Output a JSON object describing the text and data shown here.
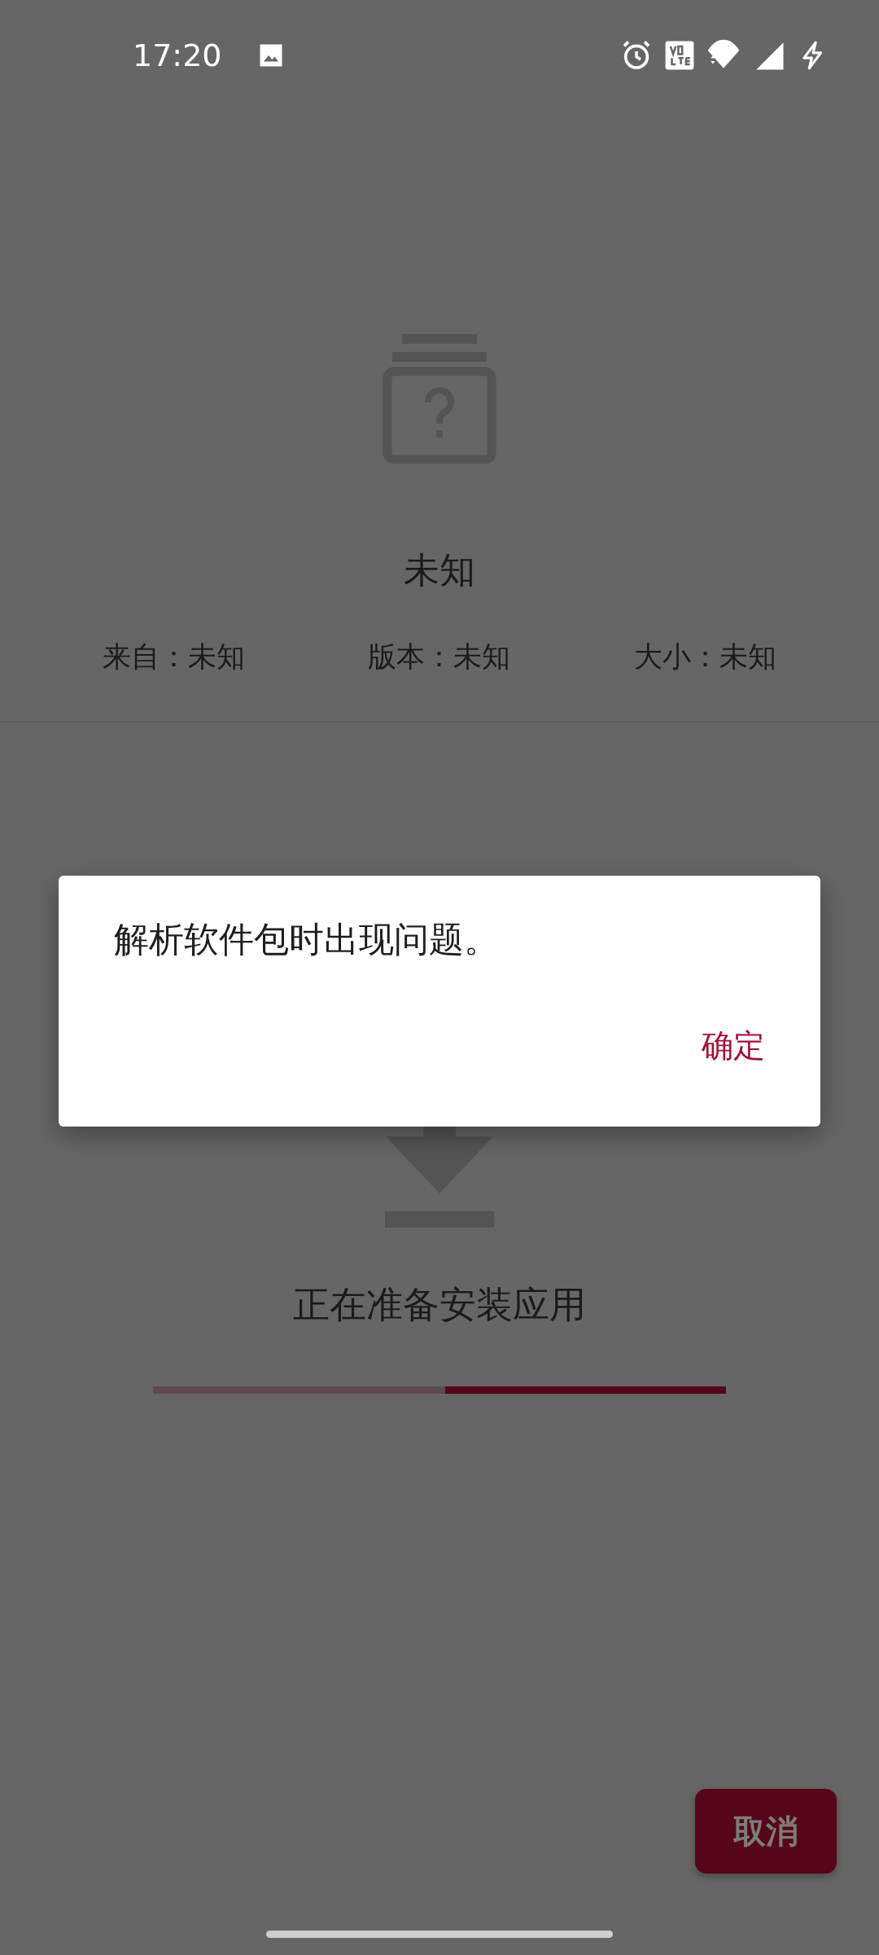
{
  "status_bar": {
    "time": "17:20"
  },
  "app_info": {
    "title": "未知",
    "details": [
      {
        "text": "来自：未知"
      },
      {
        "text": "版本：未知"
      },
      {
        "text": "大小：未知"
      }
    ]
  },
  "install": {
    "status": "正在准备安装应用",
    "progress": {
      "level": 0.49
    }
  },
  "cancel_button": {
    "label": "取消"
  },
  "dialog": {
    "message": "解析软件包时出现问题。",
    "buttons": [
      {
        "label": "确定"
      }
    ]
  }
}
